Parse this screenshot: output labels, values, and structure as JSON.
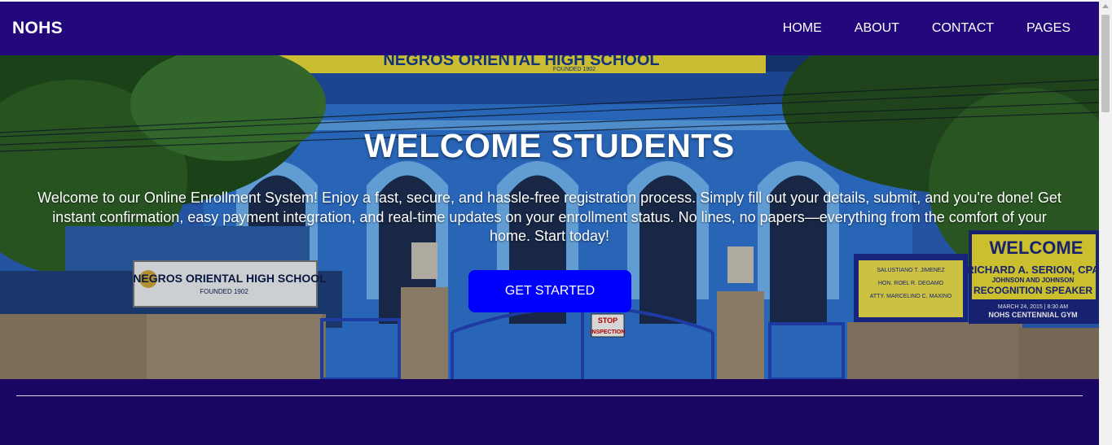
{
  "navbar": {
    "brand": "NOHS",
    "links": [
      "HOME",
      "ABOUT",
      "CONTACT",
      "PAGES"
    ]
  },
  "hero": {
    "title": "WELCOME STUDENTS",
    "description": "Welcome to our Online Enrollment System! Enjoy a fast, secure, and hassle-free registration process. Simply fill out your details, submit, and you're done! Get instant confirmation, easy payment integration, and real-time updates on your enrollment status. No lines, no papers—everything from the comfort of your home. Start today!",
    "cta_label": "GET STARTED",
    "background": {
      "school_sign_text": "NEGROS ORIENTAL HIGH SCHOOL",
      "school_sign_sub": "FOUNDED 1902",
      "building_banner_text": "NEGROS ORIENTAL HIGH SCHOOL",
      "building_banner_sub": "FOUNDED 1902",
      "stop_sign_line1": "STOP",
      "stop_sign_line2": "INSPECTION",
      "welcome_banner_title": "WELCOME",
      "welcome_banner_name": "RICHARD A. SERION, CPA",
      "welcome_banner_org": "JOHNSON AND JOHNSON",
      "welcome_banner_role": "RECOGNITION SPEAKER",
      "welcome_banner_date": "MARCH 24, 2015 | 8:30 AM",
      "welcome_banner_venue": "NOHS CENTENNIAL GYM",
      "tarp_name1": "SALUSTIANO T. JIMENEZ",
      "tarp_name2": "HON. ROEL R. DEGAMO",
      "tarp_name3": "ATTY. MARCELINO C. MAXINO"
    }
  },
  "colors": {
    "navbar_bg": "#22087a",
    "footer_bg": "#1a0563",
    "cta_bg": "#0000ff",
    "text": "#ffffff"
  }
}
